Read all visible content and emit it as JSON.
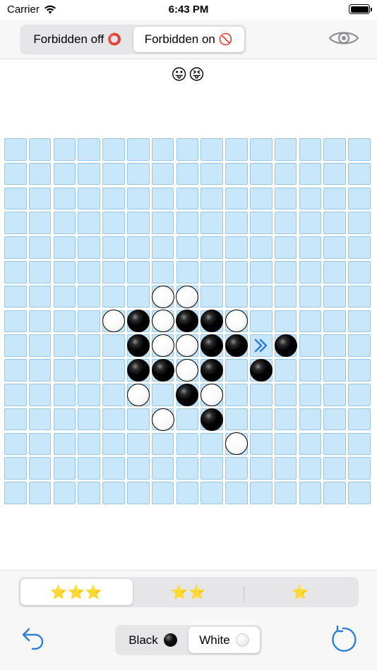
{
  "status_bar": {
    "carrier": "Carrier",
    "time": "6:43 PM"
  },
  "top_bar": {
    "forbidden_off_label": "Forbidden off",
    "forbidden_off_emoji": "⭕",
    "forbidden_on_label": "Forbidden on",
    "forbidden_on_emoji": "🚫",
    "active": "forbidden_on",
    "eye_icon": "eye-icon"
  },
  "status_emojis": "😛😝",
  "board": {
    "size": 15,
    "black_stones": [
      [
        7,
        5
      ],
      [
        7,
        7
      ],
      [
        7,
        8
      ],
      [
        8,
        5
      ],
      [
        8,
        8
      ],
      [
        8,
        9
      ],
      [
        8,
        11
      ],
      [
        9,
        5
      ],
      [
        9,
        6
      ],
      [
        9,
        8
      ],
      [
        9,
        10
      ],
      [
        10,
        7
      ],
      [
        11,
        8
      ]
    ],
    "white_stones": [
      [
        6,
        6
      ],
      [
        6,
        7
      ],
      [
        7,
        4
      ],
      [
        7,
        6
      ],
      [
        7,
        9
      ],
      [
        8,
        6
      ],
      [
        8,
        7
      ],
      [
        9,
        7
      ],
      [
        10,
        5
      ],
      [
        10,
        8
      ],
      [
        11,
        6
      ],
      [
        12,
        9
      ]
    ],
    "last_move_marker": [
      8,
      10
    ],
    "last_move_marker_icon": "double-chevron-right-icon"
  },
  "difficulty": {
    "options": [
      "⭐⭐⭐",
      "⭐⭐",
      "⭐"
    ],
    "selected_index": 0
  },
  "player_color": {
    "black_label": "Black",
    "white_label": "White",
    "selected": "white"
  },
  "colors": {
    "accent": "#2f7fd8",
    "cell_fill": "#c9e7fb",
    "cell_border": "#9cc4e3",
    "star": "#f3b800"
  }
}
